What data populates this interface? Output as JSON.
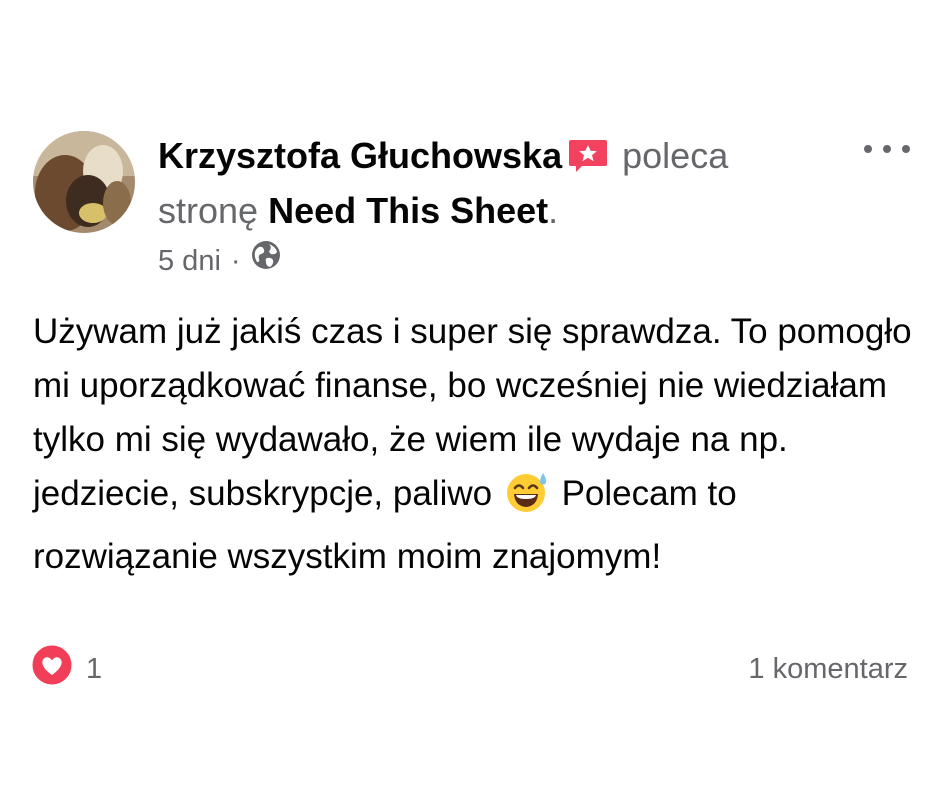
{
  "post": {
    "author": "Krzysztofa Głuchowska",
    "recommend_icon": "recommend-star-icon",
    "verb": "poleca",
    "prefix": "stronę",
    "page_name": "Need This Sheet",
    "period": ".",
    "time": "5 dni",
    "separator": "·",
    "privacy_icon": "globe-icon",
    "text_part1": "Używam już jakiś czas i super się sprawdza. To pomogło mi uporządkować finanse, bo wcześniej nie wiedziałam tylko mi się wydawało, że wiem ile wydaje na np. jedziecie, subskrypcje, paliwo",
    "emoji": "smiling-face-with-sweat-emoji",
    "text_part2": "Polecam to rozwiązanie wszystkim moim znajomym!",
    "reaction_icon": "heart-reaction-icon",
    "reaction_count": "1",
    "comments": "1 komentarz",
    "more_icon": "more-options-icon"
  },
  "colors": {
    "text": "#050505",
    "secondary": "#65676b",
    "heart": "#f33e58",
    "recommend": "#f3425f"
  }
}
